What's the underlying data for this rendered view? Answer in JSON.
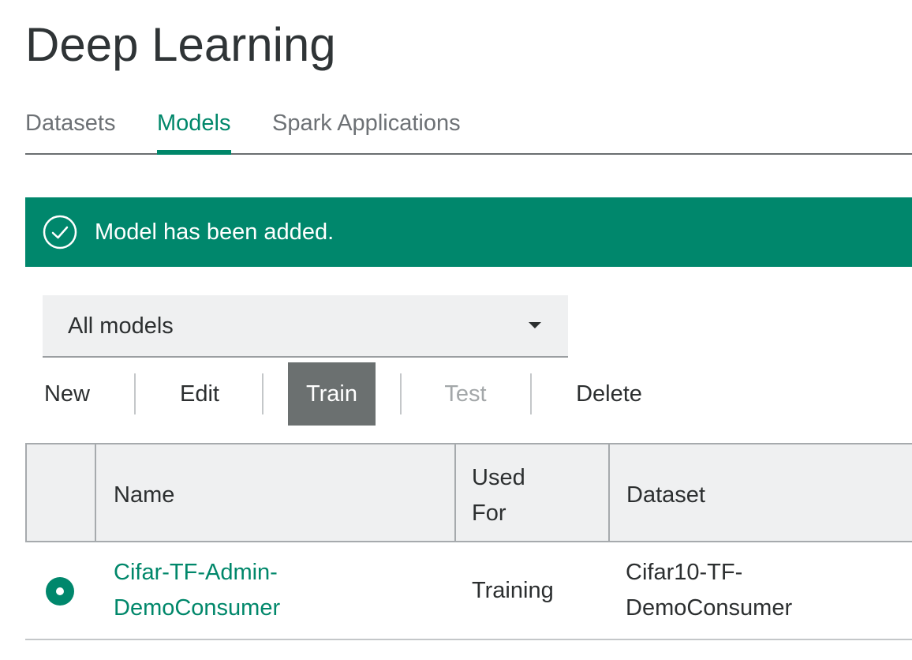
{
  "page": {
    "title": "Deep Learning"
  },
  "tabs": [
    {
      "label": "Datasets"
    },
    {
      "label": "Models",
      "active": true
    },
    {
      "label": "Spark Applications"
    }
  ],
  "notification": {
    "message": "Model has been added.",
    "icon": "checkmark-circle-icon",
    "color": "#00876c"
  },
  "filter": {
    "selected": "All models"
  },
  "toolbar": {
    "new": "New",
    "edit": "Edit",
    "train": "Train",
    "test": "Test",
    "delete": "Delete"
  },
  "table": {
    "columns": [
      "Name",
      "Used For",
      "Dataset"
    ],
    "column_lines": {
      "name": "Name",
      "used_for_1": "Used",
      "used_for_2": "For",
      "dataset": "Dataset"
    },
    "rows": [
      {
        "selected": true,
        "name_1": "Cifar-TF-Admin-",
        "name_2": "DemoConsumer",
        "used_for": "Training",
        "dataset_1": "Cifar10-TF-",
        "dataset_2": "DemoConsumer"
      }
    ]
  },
  "colors": {
    "accent": "#00876a",
    "selected_button": "#6b7070"
  }
}
